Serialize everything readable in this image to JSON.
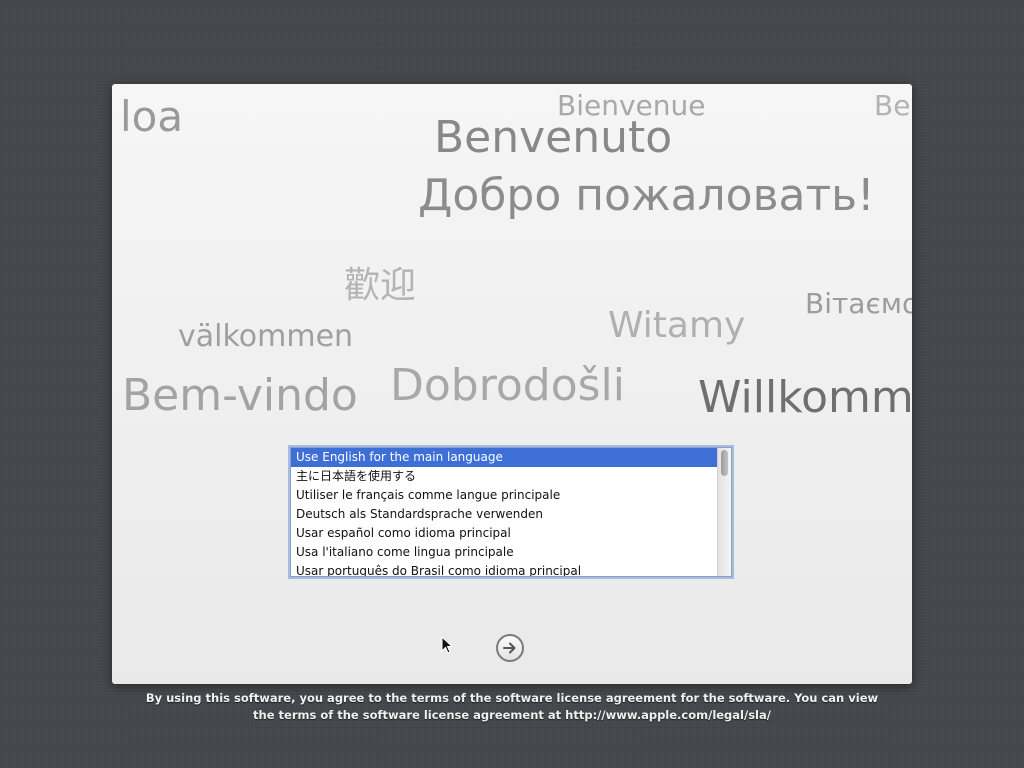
{
  "welcome_words": {
    "aloha_partial": "loa",
    "french": "Bienvenue",
    "french_partial": "Be",
    "italian": "Benvenuto",
    "russian": "Добро пожаловать!",
    "chinese": "歡迎",
    "ukrainian_partial": "Вітаємо",
    "swedish": "välkommen",
    "polish": "Witamy",
    "portuguese": "Bem-vindo",
    "croatian": "Dobrodošli",
    "german_partial": "Willkomm"
  },
  "language_list": {
    "selected_index": 0,
    "items": [
      "Use English for the main language",
      "主に日本語を使用する",
      "Utiliser le français comme langue principale",
      "Deutsch als Standardsprache verwenden",
      "Usar español como idioma principal",
      "Usa l'italiano come lingua principale",
      "Usar português do Brasil como idioma principal"
    ]
  },
  "continue_button": {
    "icon": "arrow-right-circle-icon"
  },
  "license_text": {
    "line1": "By using this software, you agree to the terms of the software license agreement for the software. You can view",
    "line2": "the terms of the software license agreement at http://www.apple.com/legal/sla/"
  },
  "colors": {
    "background": "#45474c",
    "panel": "#f0f0f0",
    "selection": "#3d6fd6",
    "focus_ring": "#6e96e1"
  }
}
